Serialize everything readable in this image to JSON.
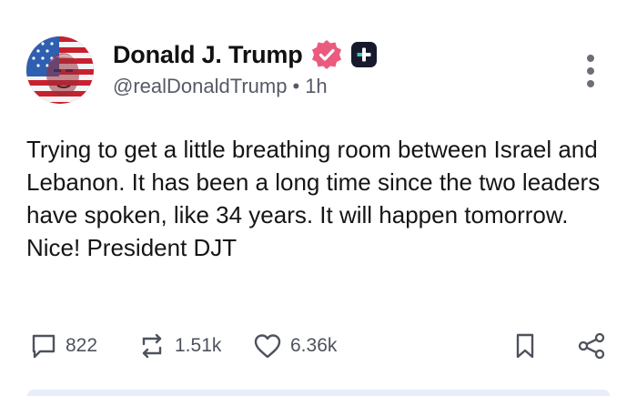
{
  "author": {
    "display_name": "Donald J. Trump",
    "handle": "@realDonaldTrump",
    "separator": "•",
    "time": "1h",
    "avatar_icon": "flag-portrait-avatar",
    "verified_icon": "verified-badge-icon",
    "plus_icon": "truth-plus-badge-icon"
  },
  "post": {
    "text": "Trying to get a little breathing room between Israel and Lebanon. It has been a long time since the two leaders have spoken, like 34 years. It will happen tomorrow. Nice! President DJT"
  },
  "actions": {
    "replies": "822",
    "retruths": "1.51k",
    "likes": "6.36k"
  },
  "colors": {
    "verified": "#ea5b7e",
    "accent_dark": "#171a2c",
    "icon_gray": "#4d525c"
  }
}
